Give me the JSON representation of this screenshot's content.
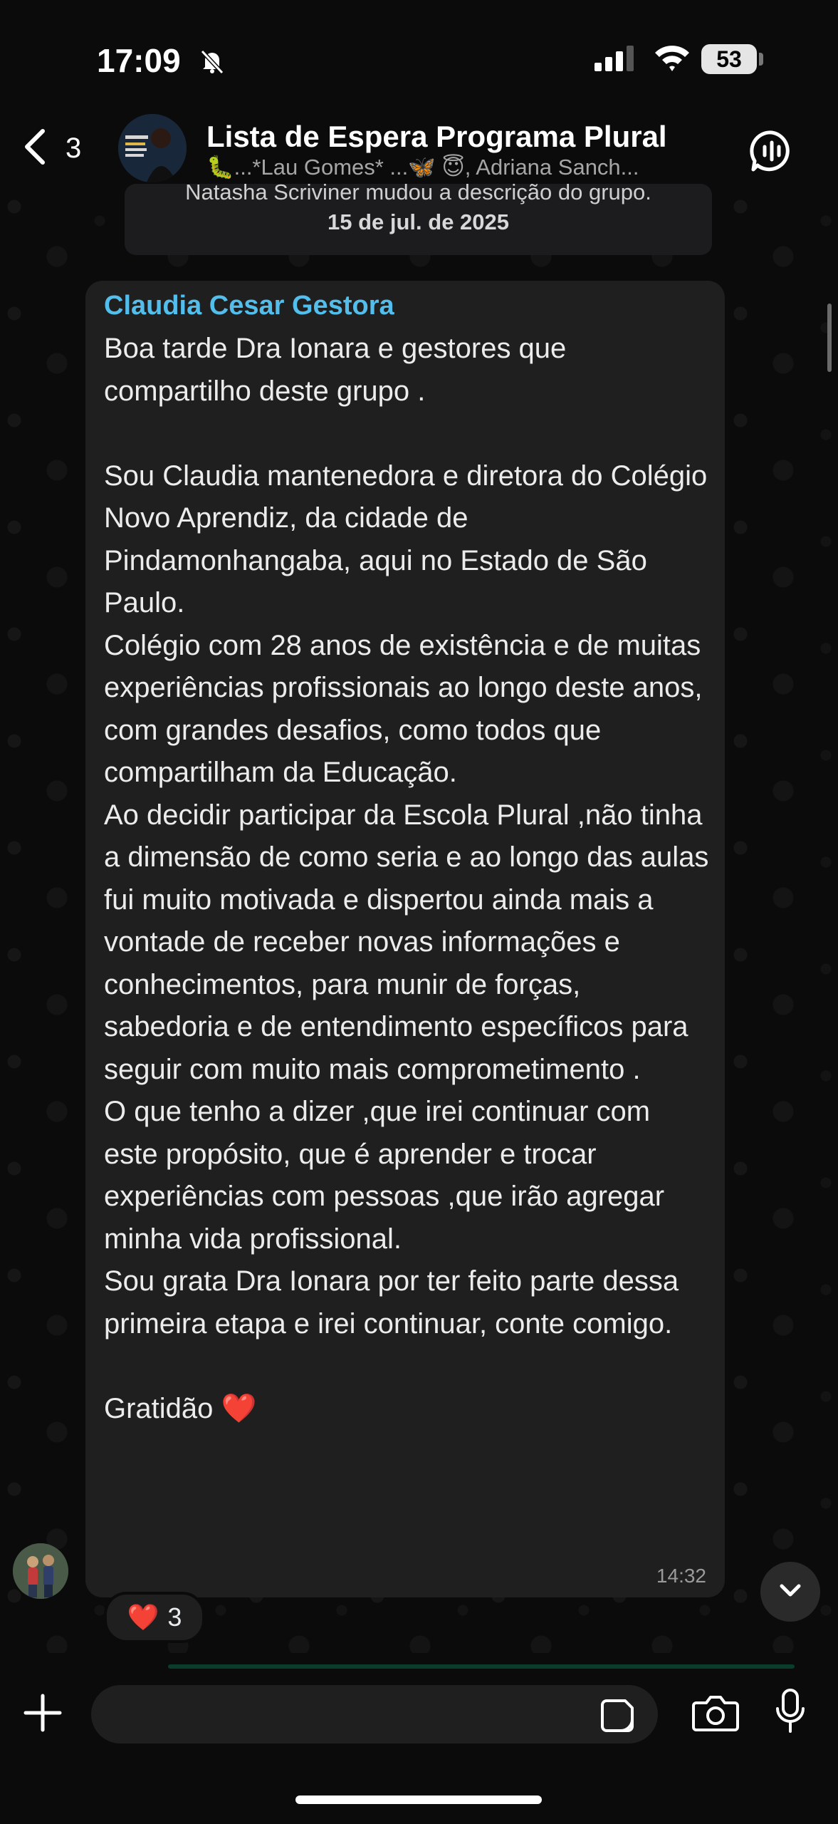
{
  "status_bar": {
    "time": "17:09",
    "battery": "53"
  },
  "header": {
    "back_count": "3",
    "title": "Lista de Espera Programa Plural",
    "subtitle": "🐛...*Lau Gomes* ...🦋   😇, Adriana Sanch..."
  },
  "system": {
    "event": "Natasha Scriviner mudou a descrição do grupo.",
    "date": "15 de jul. de 2025"
  },
  "message": {
    "sender": "Claudia Cesar Gestora",
    "text": "Boa tarde Dra Ionara e gestores que compartilho deste grupo .\n\nSou Claudia mantenedora e diretora do Colégio Novo Aprendiz, da cidade de Pindamonhangaba, aqui no Estado de São Paulo.\nColégio com 28 anos de existência e de muitas experiências profissionais ao longo deste anos,  com grandes desafios, como todos que compartilham da Educação.\nAo decidir participar da Escola Plural ,não tinha a dimensão de como seria e ao longo das aulas fui muito motivada e dispertou ainda mais a vontade de receber novas informações e conhecimentos, para munir de forças, sabedoria e de entendimento específicos para seguir com muito mais comprometimento .\nO que tenho a dizer ,que irei continuar com este propósito, que é aprender e trocar experiências com pessoas ,que irão agregar minha vida profissional.\nSou grata Dra Ionara por ter feito parte dessa primeira etapa e irei continuar, conte comigo.\n\nGratidão ❤️",
    "time": "14:32"
  },
  "reaction": {
    "emoji": "❤️",
    "count": "3"
  },
  "composer": {
    "value": ""
  },
  "colors": {
    "background": "#0b0b0b",
    "bubble": "#1f1f1f",
    "sender_name": "#53bdeb"
  }
}
